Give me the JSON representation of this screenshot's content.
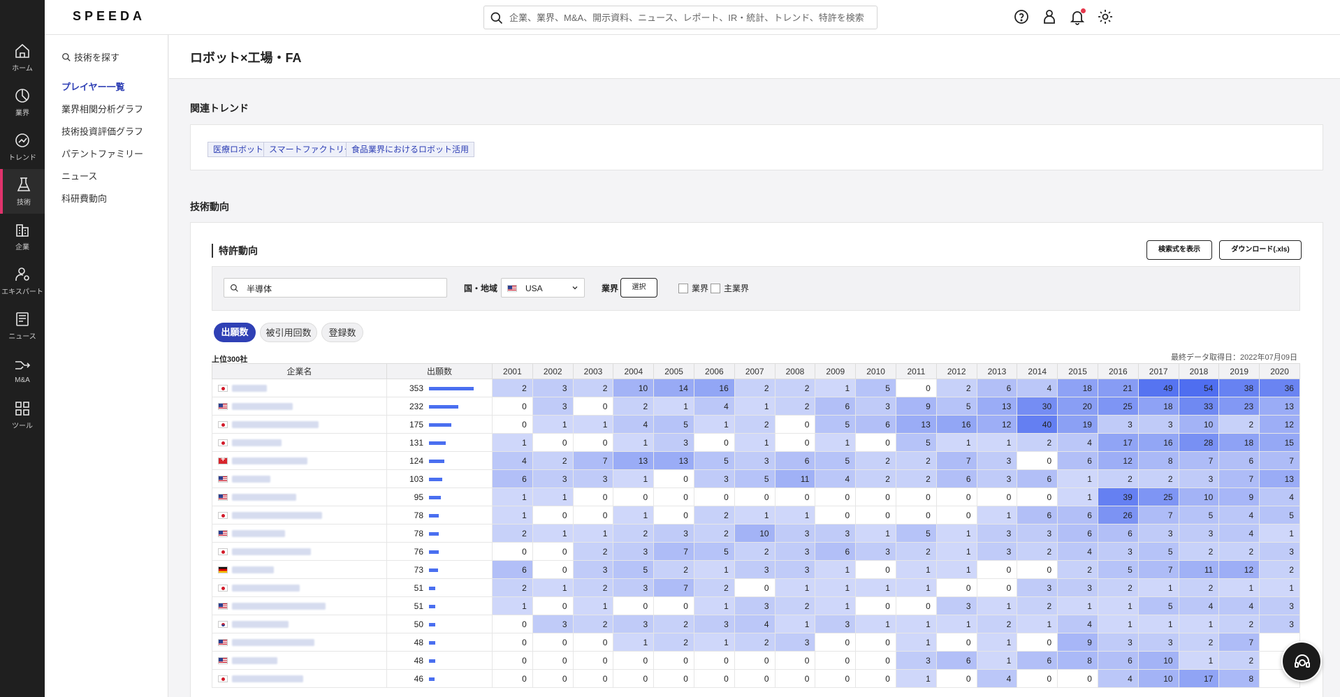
{
  "app": {
    "logo": "SPEEDA",
    "search_placeholder": "企業、業界、M&A、開示資料、ニュース、レポート、IR・統計、トレンド、特許を検索"
  },
  "rail": [
    {
      "label": "ホーム",
      "icon": "home-icon"
    },
    {
      "label": "業界",
      "icon": "pie-chart-icon"
    },
    {
      "label": "トレンド",
      "icon": "trend-icon"
    },
    {
      "label": "技術",
      "icon": "flask-icon",
      "active": true
    },
    {
      "label": "企業",
      "icon": "building-icon"
    },
    {
      "label": "エキスパート",
      "icon": "expert-icon"
    },
    {
      "label": "ニュース",
      "icon": "news-icon"
    },
    {
      "label": "M&A",
      "icon": "merge-icon"
    },
    {
      "label": "ツール",
      "icon": "grid-icon"
    }
  ],
  "subnav": {
    "find": "技術を探す",
    "items": [
      "プレイヤー一覧",
      "業界相関分析グラフ",
      "技術投資評価グラフ",
      "パテントファミリー",
      "ニュース",
      "科研費動向"
    ],
    "active_index": 0
  },
  "page": {
    "title": "ロボット×工場・FA"
  },
  "trends": {
    "title": "関連トレンド",
    "tags": [
      "医療ロボット",
      "スマートファクトリー",
      "食品業界におけるロボット活用"
    ]
  },
  "tech": {
    "title": "技術動向",
    "patent_title": "特許動向",
    "btn_query": "検索式を表示",
    "btn_download": "ダウンロード(.xls)",
    "keyword": "半導体",
    "country_label": "国・地域",
    "country_value": "USA",
    "industry_label": "業界",
    "select_btn": "選択",
    "chk_industry": "業界",
    "chk_main_industry": "主業界",
    "pills": [
      "出願数",
      "被引用回数",
      "登録数"
    ],
    "top_label": "上位300社",
    "updated": "最終データ取得日：2022年07月09日"
  },
  "table": {
    "col_company": "企業名",
    "col_count": "出願数",
    "years": [
      "2001",
      "2002",
      "2003",
      "2004",
      "2005",
      "2006",
      "2007",
      "2008",
      "2009",
      "2010",
      "2011",
      "2012",
      "2013",
      "2014",
      "2015",
      "2016",
      "2017",
      "2018",
      "2019",
      "2020"
    ],
    "max": 54,
    "rows": [
      {
        "flag": "jp",
        "total": 353,
        "v": [
          2,
          3,
          2,
          10,
          14,
          16,
          2,
          2,
          1,
          5,
          0,
          2,
          6,
          4,
          18,
          21,
          49,
          54,
          38,
          36
        ]
      },
      {
        "flag": "us",
        "total": 232,
        "v": [
          0,
          3,
          0,
          2,
          1,
          4,
          1,
          2,
          6,
          3,
          9,
          5,
          13,
          30,
          20,
          25,
          18,
          33,
          23,
          13
        ]
      },
      {
        "flag": "jp",
        "total": 175,
        "v": [
          0,
          1,
          1,
          4,
          5,
          1,
          2,
          0,
          5,
          6,
          13,
          16,
          12,
          40,
          19,
          3,
          3,
          10,
          2,
          12
        ]
      },
      {
        "flag": "jp",
        "total": 131,
        "v": [
          1,
          0,
          0,
          1,
          3,
          0,
          1,
          0,
          1,
          0,
          5,
          1,
          1,
          2,
          4,
          17,
          16,
          28,
          18,
          15
        ]
      },
      {
        "flag": "ch",
        "total": 124,
        "v": [
          4,
          2,
          7,
          13,
          13,
          5,
          3,
          6,
          5,
          2,
          2,
          7,
          3,
          0,
          6,
          12,
          8,
          7,
          6,
          7
        ]
      },
      {
        "flag": "us",
        "total": 103,
        "v": [
          6,
          3,
          3,
          1,
          0,
          3,
          5,
          11,
          4,
          2,
          2,
          6,
          3,
          6,
          1,
          2,
          2,
          3,
          7,
          13
        ]
      },
      {
        "flag": "us",
        "total": 95,
        "v": [
          1,
          1,
          0,
          0,
          0,
          0,
          0,
          0,
          0,
          0,
          0,
          0,
          0,
          0,
          1,
          39,
          25,
          10,
          9,
          4
        ]
      },
      {
        "flag": "jp",
        "total": 78,
        "v": [
          1,
          0,
          0,
          1,
          0,
          2,
          1,
          1,
          0,
          0,
          0,
          0,
          1,
          6,
          6,
          26,
          7,
          5,
          4,
          5
        ]
      },
      {
        "flag": "us",
        "total": 78,
        "v": [
          2,
          1,
          1,
          2,
          3,
          2,
          10,
          3,
          3,
          1,
          5,
          1,
          3,
          3,
          6,
          6,
          3,
          3,
          4,
          1
        ]
      },
      {
        "flag": "jp",
        "total": 76,
        "v": [
          0,
          0,
          2,
          3,
          7,
          5,
          2,
          3,
          6,
          3,
          2,
          1,
          3,
          2,
          4,
          3,
          5,
          2,
          2,
          3
        ]
      },
      {
        "flag": "de",
        "total": 73,
        "v": [
          6,
          0,
          3,
          5,
          2,
          1,
          3,
          3,
          1,
          0,
          1,
          1,
          0,
          0,
          2,
          5,
          7,
          11,
          12,
          2
        ]
      },
      {
        "flag": "jp",
        "total": 51,
        "v": [
          2,
          1,
          2,
          3,
          7,
          2,
          0,
          1,
          1,
          1,
          1,
          0,
          0,
          3,
          3,
          2,
          1,
          2,
          1,
          1
        ]
      },
      {
        "flag": "us",
        "total": 51,
        "v": [
          1,
          0,
          1,
          0,
          0,
          1,
          3,
          2,
          1,
          0,
          0,
          3,
          1,
          2,
          1,
          1,
          5,
          4,
          4,
          3
        ]
      },
      {
        "flag": "kr",
        "total": 50,
        "v": [
          0,
          3,
          2,
          3,
          2,
          3,
          4,
          1,
          3,
          1,
          1,
          1,
          2,
          1,
          4,
          1,
          1,
          1,
          2,
          3
        ]
      },
      {
        "flag": "us",
        "total": 48,
        "v": [
          0,
          0,
          0,
          1,
          2,
          1,
          2,
          3,
          0,
          0,
          1,
          0,
          1,
          0,
          9,
          3,
          3,
          2,
          7,
          ""
        ]
      },
      {
        "flag": "us",
        "total": 48,
        "v": [
          0,
          0,
          0,
          0,
          0,
          0,
          0,
          0,
          0,
          0,
          3,
          6,
          1,
          6,
          8,
          6,
          10,
          1,
          2,
          ""
        ]
      },
      {
        "flag": "jp",
        "total": 46,
        "v": [
          0,
          0,
          0,
          0,
          0,
          0,
          0,
          0,
          0,
          0,
          1,
          0,
          4,
          0,
          0,
          4,
          10,
          17,
          8,
          ""
        ]
      }
    ]
  }
}
